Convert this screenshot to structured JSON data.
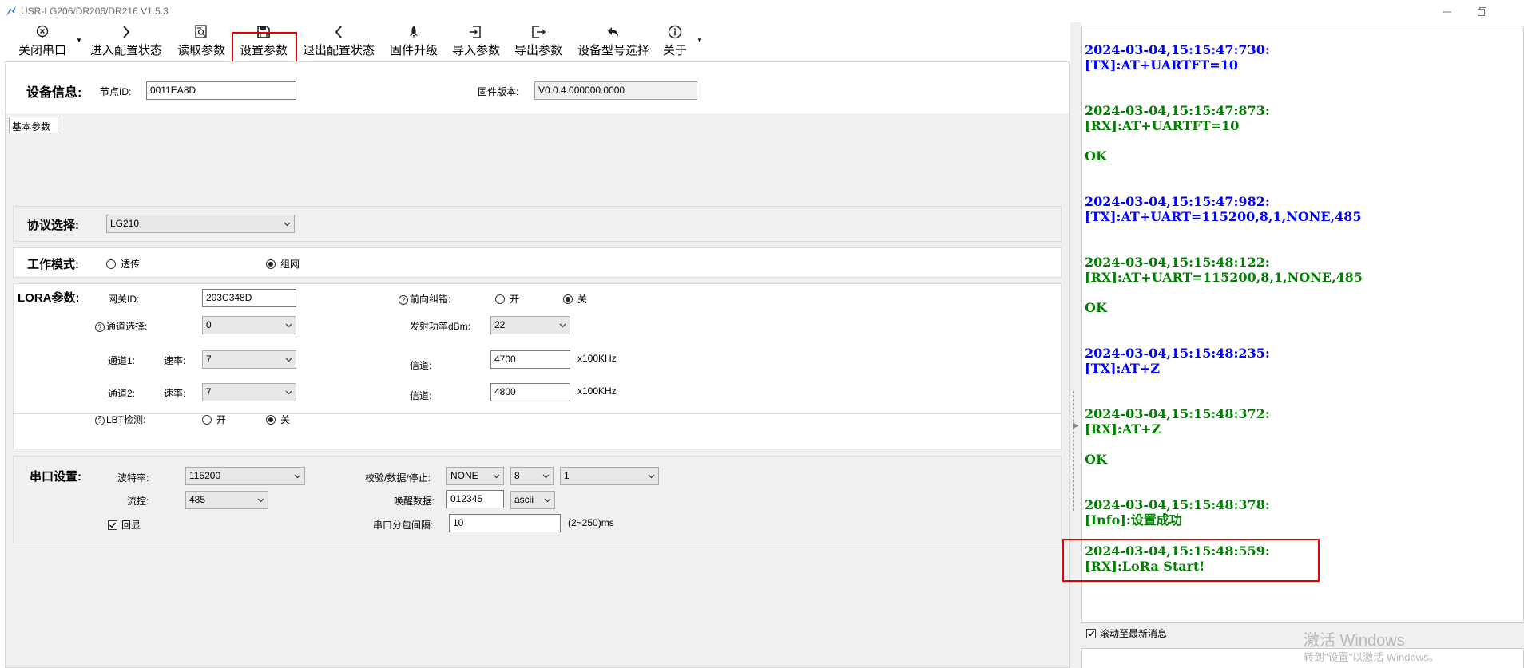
{
  "window": {
    "title": "USR-LG206/DR206/DR216 V1.5.3"
  },
  "toolbar": {
    "items": [
      {
        "label": "关闭串口"
      },
      {
        "label": "进入配置状态"
      },
      {
        "label": "读取参数"
      },
      {
        "label": "设置参数"
      },
      {
        "label": "退出配置状态"
      },
      {
        "label": "固件升级"
      },
      {
        "label": "导入参数"
      },
      {
        "label": "导出参数"
      },
      {
        "label": "设备型号选择"
      },
      {
        "label": "关于"
      }
    ]
  },
  "device_info": {
    "heading": "设备信息:",
    "node_id_label": "节点ID:",
    "node_id_value": "0011EA8D",
    "firmware_label": "固件版本:",
    "firmware_value": "V0.0.4.000000.0000"
  },
  "tabs": {
    "basic": "基本参数"
  },
  "protocol": {
    "label": "协议选择:",
    "value": "LG210"
  },
  "work_mode": {
    "label": "工作模式:",
    "option_transparent": "透传",
    "option_network": "组网",
    "selected": "组网"
  },
  "lora": {
    "heading": "LORA参数:",
    "gateway_id_label": "网关ID:",
    "gateway_id_value": "203C348D",
    "fec_label": "前向纠错:",
    "fec_on": "开",
    "fec_off": "关",
    "channel_select_label": "通道选择:",
    "channel_select_value": "0",
    "tx_power_label": "发射功率dBm:",
    "tx_power_value": "22",
    "ch1_label": "通道1:",
    "ch1_rate_label": "速率:",
    "ch1_rate_value": "7",
    "ch1_freq_label": "信道:",
    "ch1_freq_value": "4700",
    "ch1_unit": "x100KHz",
    "ch2_label": "通道2:",
    "ch2_rate_label": "速率:",
    "ch2_rate_value": "7",
    "ch2_freq_label": "信道:",
    "ch2_freq_value": "4800",
    "ch2_unit": "x100KHz",
    "lbt_label": "LBT检测:",
    "lbt_on": "开",
    "lbt_off": "关"
  },
  "serial": {
    "heading": "串口设置:",
    "baud_label": "波特率:",
    "baud_value": "115200",
    "parity_label": "校验/数据/停止:",
    "parity_value": "NONE",
    "data_bits_value": "8",
    "stop_bits_value": "1",
    "flow_label": "流控:",
    "flow_value": "485",
    "wake_label": "唤醒数据:",
    "wake_value": "012345",
    "wake_format": "ascii",
    "echo_label": "回显",
    "interval_label": "串口分包间隔:",
    "interval_value": "10",
    "interval_unit": "(2~250)ms"
  },
  "log": {
    "entries": [
      {
        "time": "2024-03-04,15:15:47:730:",
        "line": "[TX]:AT+UARTFT=10",
        "extra": "",
        "kind": "tx"
      },
      {
        "time": "2024-03-04,15:15:47:873:",
        "line": "[RX]:AT+UARTFT=10",
        "extra": "OK",
        "kind": "rx"
      },
      {
        "time": "2024-03-04,15:15:47:982:",
        "line": "[TX]:AT+UART=115200,8,1,NONE,485",
        "extra": "",
        "kind": "tx"
      },
      {
        "time": "2024-03-04,15:15:48:122:",
        "line": "[RX]:AT+UART=115200,8,1,NONE,485",
        "extra": "OK",
        "kind": "rx"
      },
      {
        "time": "2024-03-04,15:15:48:235:",
        "line": "[TX]:AT+Z",
        "extra": "",
        "kind": "tx"
      },
      {
        "time": "2024-03-04,15:15:48:372:",
        "line": "[RX]:AT+Z",
        "extra": "OK",
        "kind": "rx"
      },
      {
        "time": "2024-03-04,15:15:48:378:",
        "line": "[Info]:设置成功",
        "extra": "",
        "kind": "rx"
      },
      {
        "time": "2024-03-04,15:15:48:559:",
        "line": "[RX]:LoRa Start!",
        "extra": "",
        "kind": "rx"
      }
    ],
    "autoscroll_label": "滚动至最新消息"
  },
  "watermark": {
    "line1": "激活 Windows",
    "line2": "转到\"设置\"以激活 Windows。"
  },
  "colors": {
    "tx": "#0000ff",
    "rx": "#008000",
    "highlight": "#e60000"
  }
}
